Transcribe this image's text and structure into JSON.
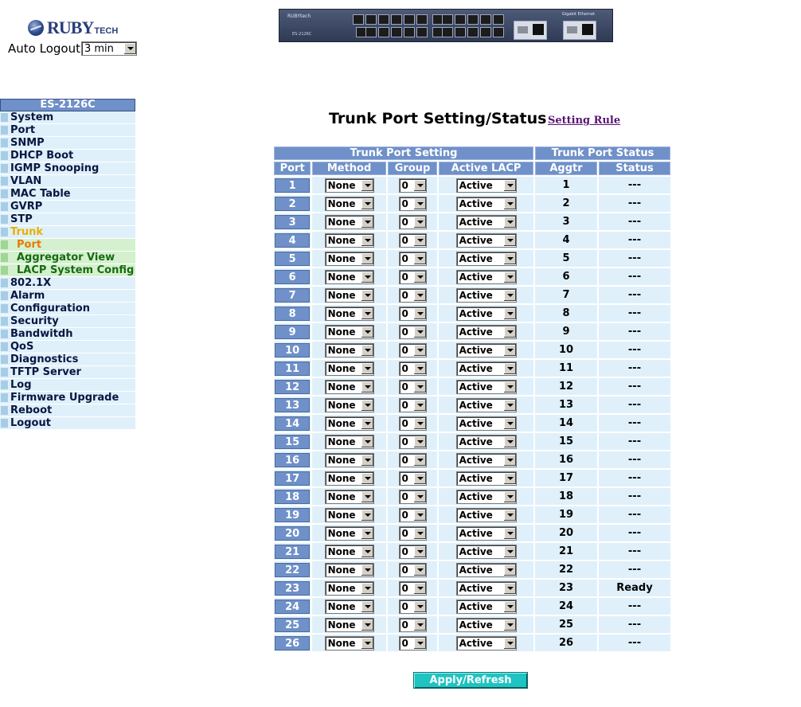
{
  "logo": {
    "brand": "RUBY",
    "suffix": "TECH"
  },
  "auto_logout": {
    "label": "Auto Logout",
    "value": "3 min"
  },
  "device": {
    "brand": "RUBYtech",
    "model": "ES-2126C",
    "gigabit_label": "Gigabit Ethernet"
  },
  "sidebar": {
    "header": "ES-2126C",
    "items": [
      {
        "label": "System"
      },
      {
        "label": "Port"
      },
      {
        "label": "SNMP"
      },
      {
        "label": "DHCP Boot"
      },
      {
        "label": "IGMP Snooping"
      },
      {
        "label": "VLAN"
      },
      {
        "label": "MAC Table"
      },
      {
        "label": "GVRP"
      },
      {
        "label": "STP"
      },
      {
        "label": "Trunk",
        "active": true,
        "children": [
          {
            "label": "Port",
            "current": true
          },
          {
            "label": "Aggregator View"
          },
          {
            "label": "LACP System Config"
          }
        ]
      },
      {
        "label": "802.1X"
      },
      {
        "label": "Alarm"
      },
      {
        "label": "Configuration"
      },
      {
        "label": "Security"
      },
      {
        "label": "Bandwitdh"
      },
      {
        "label": "QoS"
      },
      {
        "label": "Diagnostics"
      },
      {
        "label": "TFTP Server"
      },
      {
        "label": "Log"
      },
      {
        "label": "Firmware Upgrade"
      },
      {
        "label": "Reboot"
      },
      {
        "label": "Logout"
      }
    ]
  },
  "page": {
    "title": "Trunk Port Setting/Status",
    "setting_rule_link": "Setting Rule"
  },
  "table": {
    "group_headers": {
      "setting": "Trunk Port Setting",
      "status": "Trunk Port Status"
    },
    "columns": {
      "port": "Port",
      "method": "Method",
      "group": "Group",
      "active_lacp": "Active LACP",
      "aggtr": "Aggtr",
      "status": "Status"
    },
    "rows": [
      {
        "port": "1",
        "method": "None",
        "group": "0",
        "lacp": "Active",
        "aggtr": "1",
        "status": "---"
      },
      {
        "port": "2",
        "method": "None",
        "group": "0",
        "lacp": "Active",
        "aggtr": "2",
        "status": "---"
      },
      {
        "port": "3",
        "method": "None",
        "group": "0",
        "lacp": "Active",
        "aggtr": "3",
        "status": "---"
      },
      {
        "port": "4",
        "method": "None",
        "group": "0",
        "lacp": "Active",
        "aggtr": "4",
        "status": "---"
      },
      {
        "port": "5",
        "method": "None",
        "group": "0",
        "lacp": "Active",
        "aggtr": "5",
        "status": "---"
      },
      {
        "port": "6",
        "method": "None",
        "group": "0",
        "lacp": "Active",
        "aggtr": "6",
        "status": "---"
      },
      {
        "port": "7",
        "method": "None",
        "group": "0",
        "lacp": "Active",
        "aggtr": "7",
        "status": "---"
      },
      {
        "port": "8",
        "method": "None",
        "group": "0",
        "lacp": "Active",
        "aggtr": "8",
        "status": "---"
      },
      {
        "port": "9",
        "method": "None",
        "group": "0",
        "lacp": "Active",
        "aggtr": "9",
        "status": "---"
      },
      {
        "port": "10",
        "method": "None",
        "group": "0",
        "lacp": "Active",
        "aggtr": "10",
        "status": "---"
      },
      {
        "port": "11",
        "method": "None",
        "group": "0",
        "lacp": "Active",
        "aggtr": "11",
        "status": "---"
      },
      {
        "port": "12",
        "method": "None",
        "group": "0",
        "lacp": "Active",
        "aggtr": "12",
        "status": "---"
      },
      {
        "port": "13",
        "method": "None",
        "group": "0",
        "lacp": "Active",
        "aggtr": "13",
        "status": "---"
      },
      {
        "port": "14",
        "method": "None",
        "group": "0",
        "lacp": "Active",
        "aggtr": "14",
        "status": "---"
      },
      {
        "port": "15",
        "method": "None",
        "group": "0",
        "lacp": "Active",
        "aggtr": "15",
        "status": "---"
      },
      {
        "port": "16",
        "method": "None",
        "group": "0",
        "lacp": "Active",
        "aggtr": "16",
        "status": "---"
      },
      {
        "port": "17",
        "method": "None",
        "group": "0",
        "lacp": "Active",
        "aggtr": "17",
        "status": "---"
      },
      {
        "port": "18",
        "method": "None",
        "group": "0",
        "lacp": "Active",
        "aggtr": "18",
        "status": "---"
      },
      {
        "port": "19",
        "method": "None",
        "group": "0",
        "lacp": "Active",
        "aggtr": "19",
        "status": "---"
      },
      {
        "port": "20",
        "method": "None",
        "group": "0",
        "lacp": "Active",
        "aggtr": "20",
        "status": "---"
      },
      {
        "port": "21",
        "method": "None",
        "group": "0",
        "lacp": "Active",
        "aggtr": "21",
        "status": "---"
      },
      {
        "port": "22",
        "method": "None",
        "group": "0",
        "lacp": "Active",
        "aggtr": "22",
        "status": "---"
      },
      {
        "port": "23",
        "method": "None",
        "group": "0",
        "lacp": "Active",
        "aggtr": "23",
        "status": "Ready"
      },
      {
        "port": "24",
        "method": "None",
        "group": "0",
        "lacp": "Active",
        "aggtr": "24",
        "status": "---"
      },
      {
        "port": "25",
        "method": "None",
        "group": "0",
        "lacp": "Active",
        "aggtr": "25",
        "status": "---"
      },
      {
        "port": "26",
        "method": "None",
        "group": "0",
        "lacp": "Active",
        "aggtr": "26",
        "status": "---"
      }
    ]
  },
  "apply_button": "Apply/Refresh"
}
